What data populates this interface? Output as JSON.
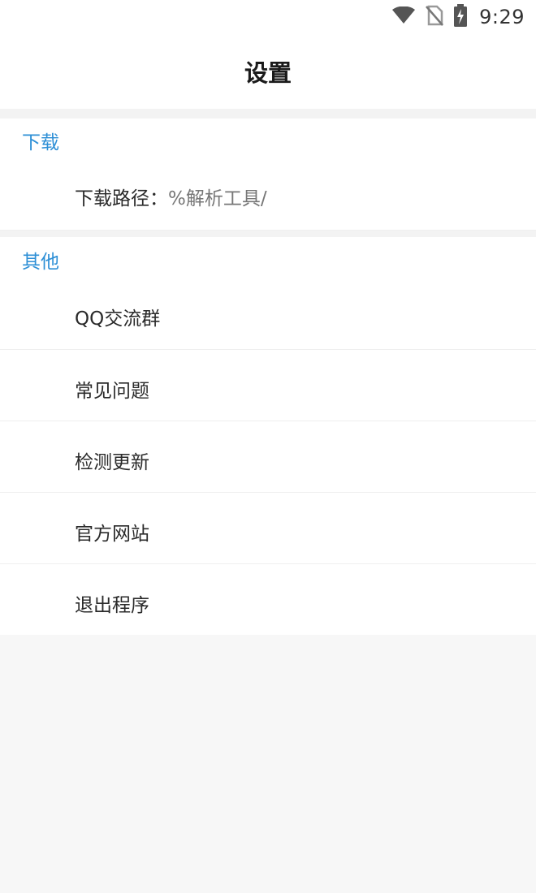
{
  "status_bar": {
    "time": "9:29",
    "icons": [
      "wifi-icon",
      "no-sim-icon",
      "battery-charging-icon"
    ]
  },
  "header": {
    "title": "设置"
  },
  "sections": [
    {
      "title": "下载",
      "items": [
        {
          "label": "下载路径：",
          "value": "%解析工具/"
        }
      ]
    },
    {
      "title": "其他",
      "items": [
        {
          "label": "QQ交流群"
        },
        {
          "label": "常见问题"
        },
        {
          "label": "检测更新"
        },
        {
          "label": "官方网站"
        },
        {
          "label": "退出程序"
        }
      ]
    }
  ],
  "colors": {
    "section_title": "#2d8fd6",
    "background": "#f7f7f7",
    "row_background": "#ffffff"
  }
}
